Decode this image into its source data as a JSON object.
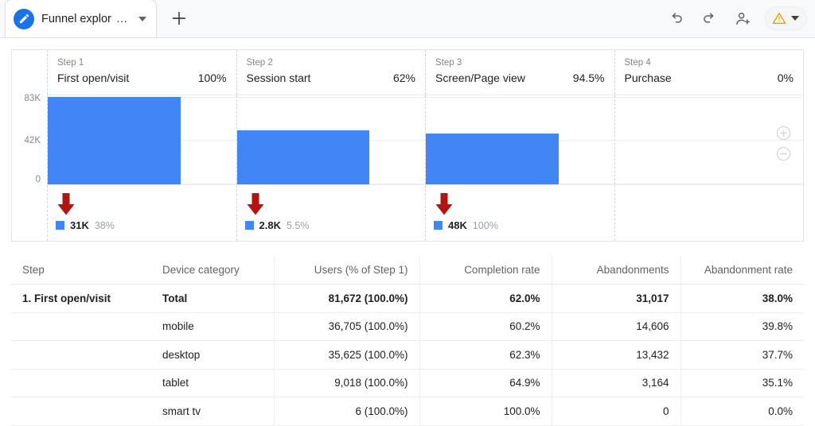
{
  "topbar": {
    "tab_title": "Funnel explor",
    "tab_ellipsis": "…",
    "edit_icon": "pencil-icon",
    "tab_caret_icon": "chevron-down-icon",
    "add_tab_icon": "plus-icon",
    "undo_icon": "undo-arrow-icon",
    "redo_icon": "redo-arrow-icon",
    "share_icon": "add-person-icon",
    "warning_icon": "warning-triangle-icon",
    "warning_caret_icon": "chevron-down-icon",
    "warning_color": "#F29900"
  },
  "chart": {
    "bar_color": "#4285F4",
    "arrow_color": "#B31412",
    "y_axis": {
      "labels": [
        "83K",
        "42K",
        "0"
      ],
      "max": 83000,
      "min": 0
    },
    "zoom_in_icon": "zoom-in-icon",
    "zoom_out_icon": "zoom-out-icon"
  },
  "chart_data": {
    "type": "bar",
    "title": "",
    "xlabel": "",
    "ylabel": "",
    "ylim": [
      0,
      83000
    ],
    "grid": true,
    "categories": [
      "First open/visit",
      "Session start",
      "Screen/Page view",
      "Purchase"
    ],
    "step_labels": [
      "Step 1",
      "Step 2",
      "Step 3",
      "Step 4"
    ],
    "completion_pct_labels": [
      "100%",
      "62%",
      "94.5%",
      "0%"
    ],
    "values": [
      81672,
      50655,
      47855,
      0
    ],
    "tick_labels": [
      "83K",
      "42K",
      "0"
    ],
    "abandonments": [
      {
        "value_label": "31K",
        "pct_label": "38%"
      },
      {
        "value_label": "2.8K",
        "pct_label": "5.5%"
      },
      {
        "value_label": "48K",
        "pct_label": "100%"
      },
      {
        "value_label": "",
        "pct_label": ""
      }
    ],
    "series": [
      {
        "name": "Users",
        "values": [
          81672,
          50655,
          47855,
          0
        ]
      }
    ]
  },
  "steps": [
    {
      "num": "Step 1",
      "name": "First open/visit",
      "pct": "100%",
      "bar_height_pct": 98.0,
      "aband_value": "31K",
      "aband_pct": "38%",
      "has_aband": true
    },
    {
      "num": "Step 2",
      "name": "Session start",
      "pct": "62%",
      "bar_height_pct": 60.5,
      "aband_value": "2.8K",
      "aband_pct": "5.5%",
      "has_aband": true
    },
    {
      "num": "Step 3",
      "name": "Screen/Page view",
      "pct": "94.5%",
      "bar_height_pct": 57.0,
      "aband_value": "48K",
      "aband_pct": "100%",
      "has_aband": true
    },
    {
      "num": "Step 4",
      "name": "Purchase",
      "pct": "0%",
      "bar_height_pct": 0,
      "aband_value": "",
      "aband_pct": "",
      "has_aband": false
    }
  ],
  "table": {
    "headers": [
      "Step",
      "Device category",
      "Users (% of Step 1)",
      "Completion rate",
      "Abandonments",
      "Abandonment rate"
    ],
    "rows": [
      {
        "step": "1. First open/visit",
        "device": "Total",
        "users": "81,672 (100.0%)",
        "completion": "62.0%",
        "abandonments": "31,017",
        "aband_rate": "38.0%",
        "bold": true
      },
      {
        "step": "",
        "device": "mobile",
        "users": "36,705 (100.0%)",
        "completion": "60.2%",
        "abandonments": "14,606",
        "aband_rate": "39.8%",
        "bold": false
      },
      {
        "step": "",
        "device": "desktop",
        "users": "35,625 (100.0%)",
        "completion": "62.3%",
        "abandonments": "13,432",
        "aband_rate": "37.7%",
        "bold": false
      },
      {
        "step": "",
        "device": "tablet",
        "users": "9,018 (100.0%)",
        "completion": "64.9%",
        "abandonments": "3,164",
        "aband_rate": "35.1%",
        "bold": false
      },
      {
        "step": "",
        "device": "smart tv",
        "users": "6 (100.0%)",
        "completion": "100.0%",
        "abandonments": "0",
        "aband_rate": "0.0%",
        "bold": false
      }
    ]
  }
}
